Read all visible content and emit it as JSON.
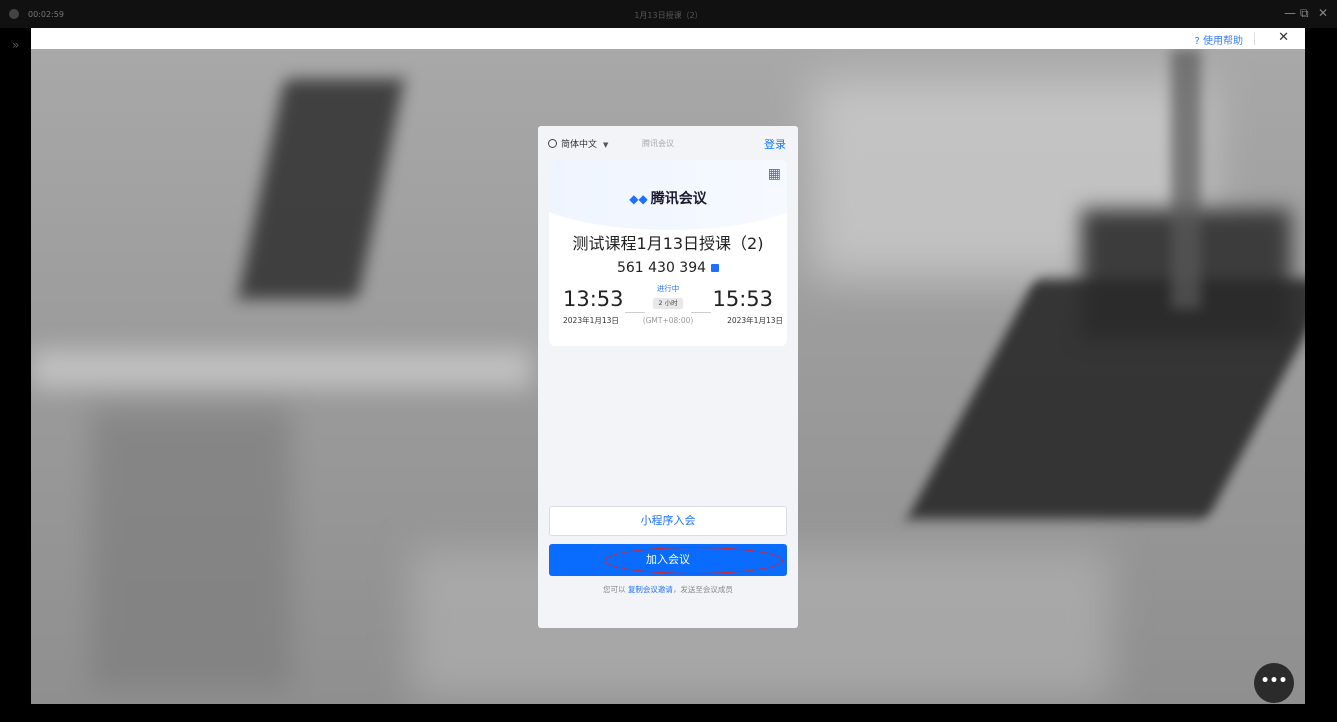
{
  "outer_window": {
    "timer": "00:02:59",
    "title": "1月13日授课（2）",
    "minimize": "—",
    "restore": "⧉",
    "close": "✕",
    "side_chevron": "»"
  },
  "help_bar": {
    "help_label": "? 使用帮助",
    "close_label": "✕"
  },
  "card": {
    "language": "简体中文",
    "watermark": "腾讯会议",
    "login": "登录",
    "brand": "腾讯会议",
    "brand_mark": "◆◆",
    "qr_icon": "▦",
    "meeting_title": "测试课程1月13日授课（2)",
    "meeting_id": "561 430 394",
    "start_time": "13:53",
    "start_date": "2023年1月13日",
    "end_time": "15:53",
    "end_date": "2023年1月13日",
    "status": "进行中",
    "duration": "2 小时",
    "timezone": "(GMT+08:00)",
    "mini_program_btn": "小程序入会",
    "join_btn": "加入会议",
    "hint_prefix": "您可以 ",
    "hint_link": "复制会议邀请",
    "hint_suffix": "，发送至会议成员"
  },
  "more_button": "•••",
  "colors": {
    "accent": "#0a6cff",
    "annotation_ring": "#e02020"
  }
}
